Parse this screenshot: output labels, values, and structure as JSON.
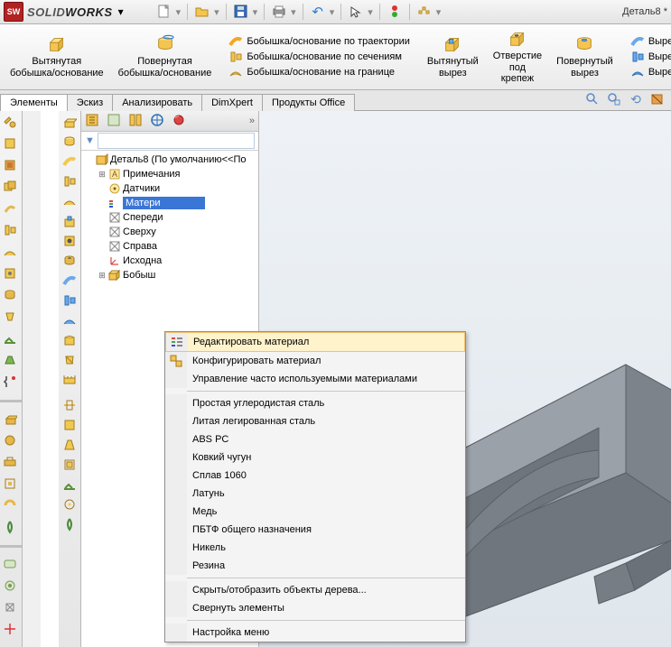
{
  "app": {
    "brand1": "SOLID",
    "brand2": "WORKS",
    "doc_title": "Деталь8 *"
  },
  "ribbon": {
    "extrude_boss": "Вытянутая\nбобышка/основание",
    "revolve_boss": "Повернутая\nбобышка/основание",
    "sweep": "Бобышка/основание по траектории",
    "loft": "Бобышка/основание по сечениям",
    "boundary": "Бобышка/основание на границе",
    "extrude_cut": "Вытянутый\nвырез",
    "hole": "Отверстие\nпод\nкрепеж",
    "revolve_cut": "Повернутый\nвырез",
    "sweep_cut": "Вырез по тр",
    "loft_cut": "Вырез по се",
    "boundary_cut": "Вырез по гр"
  },
  "tabs": {
    "t1": "Элементы",
    "t2": "Эскиз",
    "t3": "Анализировать",
    "t4": "DimXpert",
    "t5": "Продукты Office"
  },
  "tree": {
    "root": "Деталь8  (По умолчанию<<По",
    "annotations": "Примечания",
    "sensors": "Датчики",
    "material": "Матери",
    "front": "Спереди",
    "top": "Сверху",
    "right": "Справа",
    "origin": "Исходна",
    "boss": "Бобыш"
  },
  "ctx": {
    "edit": "Редактировать материал",
    "configure": "Конфигурировать материал",
    "manage": "Управление часто используемыми материалами",
    "m1": "Простая углеродистая сталь",
    "m2": "Литая легированная сталь",
    "m3": "ABS PC",
    "m4": "Ковкий чугун",
    "m5": "Сплав 1060",
    "m6": "Латунь",
    "m7": "Медь",
    "m8": "ПБТФ общего назначения",
    "m9": "Никель",
    "m10": "Резина",
    "hide": "Скрыть/отобразить объекты дерева...",
    "collapse": "Свернуть элементы",
    "customize": "Настройка меню"
  }
}
